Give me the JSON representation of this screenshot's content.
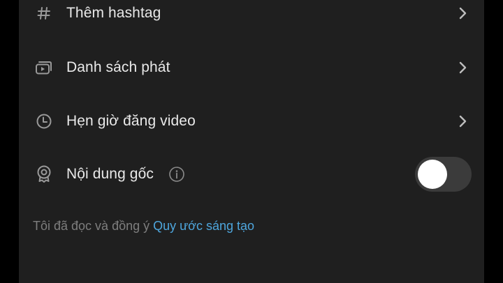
{
  "settings": {
    "items": [
      {
        "icon": "hashtag-icon",
        "label": "Thêm hashtag",
        "has_chevron": true
      },
      {
        "icon": "playlist-icon",
        "label": "Danh sách phát",
        "has_chevron": true
      },
      {
        "icon": "clock-icon",
        "label": "Hẹn giờ đăng video",
        "has_chevron": true
      },
      {
        "icon": "original-content-badge-icon",
        "label": "Nội dung gốc",
        "has_info": true,
        "toggle_on": false
      }
    ]
  },
  "footer": {
    "text": "Tôi đã đọc và đồng ý ",
    "link": "Quy ước sáng tạo"
  },
  "colors": {
    "panel_bg": "#1f1f1f",
    "text": "#e9e9e9",
    "muted": "#7e7e7e",
    "link": "#4ea6dd",
    "toggle_track": "#3b3b3b"
  }
}
